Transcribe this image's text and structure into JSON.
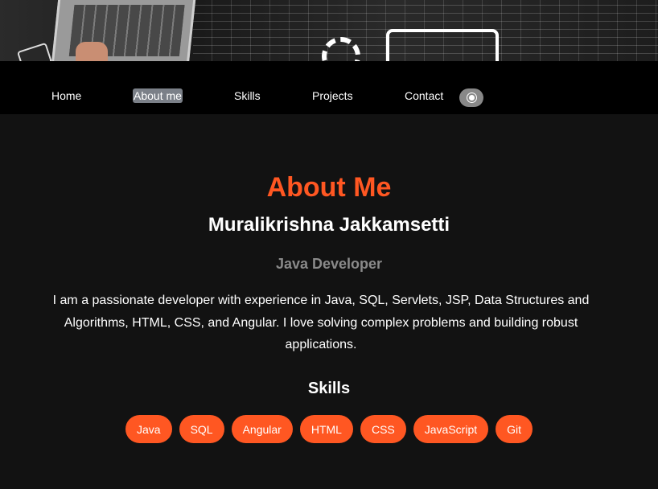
{
  "nav": {
    "items": [
      {
        "label": "Home",
        "active": false
      },
      {
        "label": "About me",
        "active": true
      },
      {
        "label": "Skills",
        "active": false
      },
      {
        "label": "Projects",
        "active": false
      },
      {
        "label": "Contact",
        "active": false
      }
    ],
    "theme_toggle_icon": "sun-icon"
  },
  "about": {
    "heading": "About Me",
    "name": "Muralikrishna Jakkamsetti",
    "role": "Java Developer",
    "bio": "I am a passionate developer with experience in Java, SQL, Servlets, JSP, Data Structures and Algorithms, HTML, CSS, and Angular. I love solving complex problems and building robust applications."
  },
  "skills": {
    "title": "Skills",
    "items": [
      "Java",
      "SQL",
      "Angular",
      "HTML",
      "CSS",
      "JavaScript",
      "Git"
    ]
  },
  "colors": {
    "accent": "#ff5722",
    "background": "#121212",
    "nav_background": "#000000",
    "active_nav": "#7b8088",
    "muted_text": "#8a8a8a"
  }
}
